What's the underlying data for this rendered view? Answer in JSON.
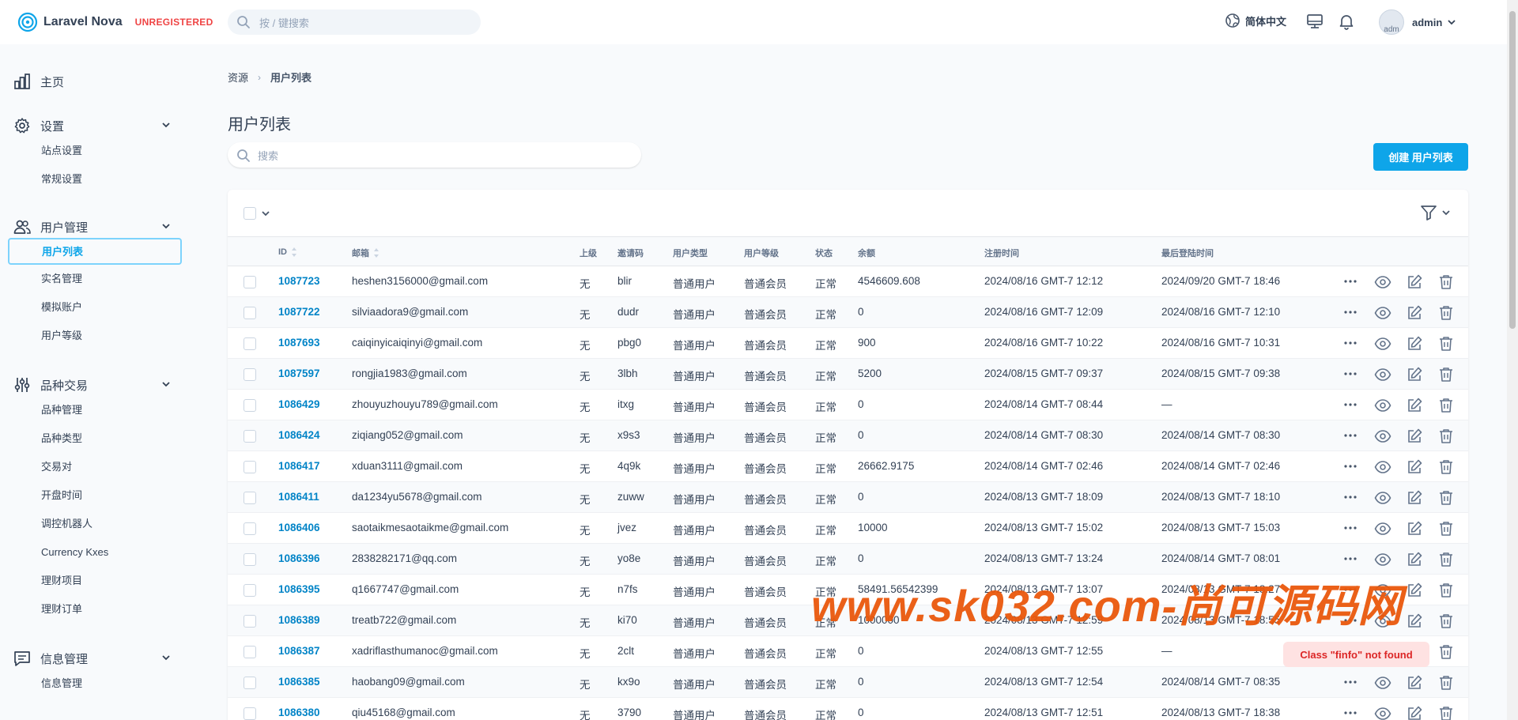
{
  "topbar": {
    "brand_name": "Laravel Nova",
    "brand_badge": "UNREGISTERED",
    "search_placeholder": "按 / 键搜索",
    "language": "简体中文",
    "user_name": "admin",
    "avatar_alt": "adm"
  },
  "sidebar": {
    "home": "主页",
    "groups": [
      {
        "label": "设置",
        "items": [
          "站点设置",
          "常规设置"
        ]
      },
      {
        "label": "用户管理",
        "items": [
          "用户列表",
          "实名管理",
          "模拟账户",
          "用户等级"
        ]
      },
      {
        "label": "品种交易",
        "items": [
          "品种管理",
          "品种类型",
          "交易对",
          "开盘时间",
          "调控机器人",
          "Currency Kxes",
          "理财项目",
          "理财订单"
        ]
      },
      {
        "label": "信息管理",
        "items": [
          "信息管理"
        ]
      }
    ],
    "active_item": "用户列表"
  },
  "breadcrumb": {
    "root": "资源",
    "current": "用户列表"
  },
  "page": {
    "title": "用户列表",
    "search_placeholder": "搜索",
    "create_button": "创建 用户列表"
  },
  "table": {
    "columns": [
      "ID",
      "邮箱",
      "上级",
      "邀请码",
      "用户类型",
      "用户等级",
      "状态",
      "余额",
      "注册时间",
      "最后登陆时间"
    ],
    "rows": [
      [
        "1087723",
        "heshen3156000@gmail.com",
        "无",
        "blir",
        "普通用户",
        "普通会员",
        "正常",
        "4546609.608",
        "2024/08/16 GMT-7 12:12",
        "2024/09/20 GMT-7 18:46"
      ],
      [
        "1087722",
        "silviaadora9@gmail.com",
        "无",
        "dudr",
        "普通用户",
        "普通会员",
        "正常",
        "0",
        "2024/08/16 GMT-7 12:09",
        "2024/08/16 GMT-7 12:10"
      ],
      [
        "1087693",
        "caiqinyicaiqinyi@gmail.com",
        "无",
        "pbg0",
        "普通用户",
        "普通会员",
        "正常",
        "900",
        "2024/08/16 GMT-7 10:22",
        "2024/08/16 GMT-7 10:31"
      ],
      [
        "1087597",
        "rongjia1983@gmail.com",
        "无",
        "3lbh",
        "普通用户",
        "普通会员",
        "正常",
        "5200",
        "2024/08/15 GMT-7 09:37",
        "2024/08/15 GMT-7 09:38"
      ],
      [
        "1086429",
        "zhouyuzhouyu789@gmail.com",
        "无",
        "itxg",
        "普通用户",
        "普通会员",
        "正常",
        "0",
        "2024/08/14 GMT-7 08:44",
        "—"
      ],
      [
        "1086424",
        "ziqiang052@gmail.com",
        "无",
        "x9s3",
        "普通用户",
        "普通会员",
        "正常",
        "0",
        "2024/08/14 GMT-7 08:30",
        "2024/08/14 GMT-7 08:30"
      ],
      [
        "1086417",
        "xduan3111@gmail.com",
        "无",
        "4q9k",
        "普通用户",
        "普通会员",
        "正常",
        "26662.9175",
        "2024/08/14 GMT-7 02:46",
        "2024/08/14 GMT-7 02:46"
      ],
      [
        "1086411",
        "da1234yu5678@gmail.com",
        "无",
        "zuww",
        "普通用户",
        "普通会员",
        "正常",
        "0",
        "2024/08/13 GMT-7 18:09",
        "2024/08/13 GMT-7 18:10"
      ],
      [
        "1086406",
        "saotaikmesaotaikme@gmail.com",
        "无",
        "jvez",
        "普通用户",
        "普通会员",
        "正常",
        "10000",
        "2024/08/13 GMT-7 15:02",
        "2024/08/13 GMT-7 15:03"
      ],
      [
        "1086396",
        "2838282171@qq.com",
        "无",
        "yo8e",
        "普通用户",
        "普通会员",
        "正常",
        "0",
        "2024/08/13 GMT-7 13:24",
        "2024/08/14 GMT-7 08:01"
      ],
      [
        "1086395",
        "q1667747@gmail.com",
        "无",
        "n7fs",
        "普通用户",
        "普通会员",
        "正常",
        "58491.56542399",
        "2024/08/13 GMT-7 13:07",
        "2024/08/13 GMT-7 18:27"
      ],
      [
        "1086389",
        "treatb722@gmail.com",
        "无",
        "ki70",
        "普通用户",
        "普通会员",
        "正常",
        "1000000",
        "2024/08/13 GMT-7 12:59",
        "2024/08/13 GMT-7 18:55"
      ],
      [
        "1086387",
        "xadriflasthumanoc@gmail.com",
        "无",
        "2clt",
        "普通用户",
        "普通会员",
        "正常",
        "0",
        "2024/08/13 GMT-7 12:55",
        "—"
      ],
      [
        "1086385",
        "haobang09@gmail.com",
        "无",
        "kx9o",
        "普通用户",
        "普通会员",
        "正常",
        "0",
        "2024/08/13 GMT-7 12:54",
        "2024/08/14 GMT-7 08:35"
      ],
      [
        "1086380",
        "qiu45168@gmail.com",
        "无",
        "3790",
        "普通用户",
        "普通会员",
        "正常",
        "0",
        "2024/08/13 GMT-7 12:51",
        "2024/08/13 GMT-7 18:38"
      ]
    ]
  },
  "watermark": "www.sk032.com-尚可源码网",
  "toast": "Class \"finfo\" not found",
  "colors": {
    "accent": "#0ea5e9",
    "link": "#0284c7",
    "danger": "#ef4444",
    "watermark": "#ea580c"
  }
}
